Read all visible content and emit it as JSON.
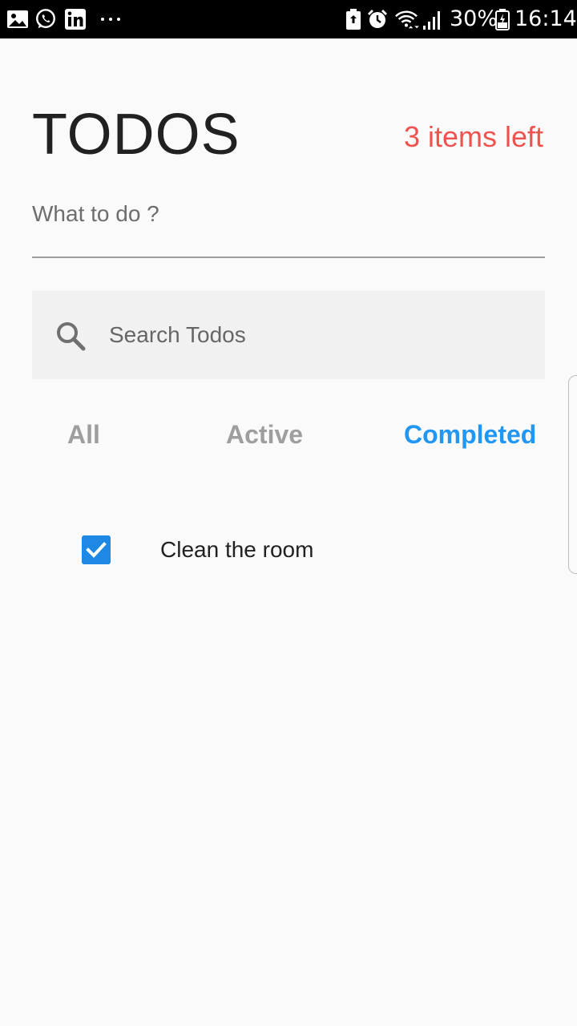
{
  "status_bar": {
    "icons": [
      "gallery-icon",
      "whatsapp-icon",
      "linkedin-icon",
      "more-notifications-icon",
      "battery-saver-icon",
      "alarm-icon",
      "wifi-icon",
      "signal-icon",
      "battery-icon"
    ],
    "battery_percent": "30%",
    "time": "16:14"
  },
  "header": {
    "title": "TODOS",
    "items_left": "3 items left"
  },
  "new_todo": {
    "placeholder": "What to do ?",
    "value": ""
  },
  "search": {
    "placeholder": "Search Todos",
    "value": ""
  },
  "filters": {
    "tabs": [
      {
        "label": "All",
        "selected": false
      },
      {
        "label": "Active",
        "selected": false
      },
      {
        "label": "Completed",
        "selected": true
      }
    ]
  },
  "todos": [
    {
      "text": "Clean the room",
      "completed": true
    }
  ],
  "colors": {
    "accent": "#2196f3",
    "items_left": "#ef5350",
    "checkbox": "#1e88e5",
    "background": "#fafafa",
    "search_background": "#f1f1f1"
  }
}
